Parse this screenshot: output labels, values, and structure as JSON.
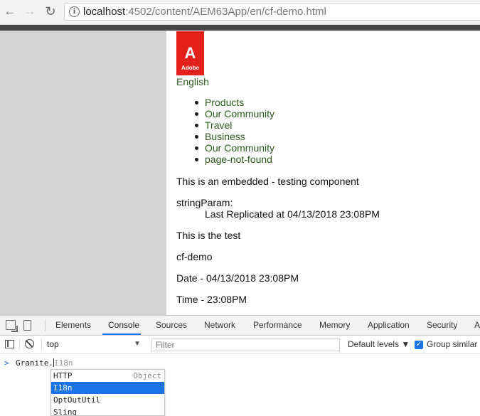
{
  "browser": {
    "url_host": "localhost",
    "url_rest": ":4502/content/AEM63App/en/cf-demo.html"
  },
  "page": {
    "logo_glyph": "A",
    "logo_text": "Adobe",
    "language": "English",
    "nav_items": [
      "Products",
      "Our Community",
      "Travel",
      "Business",
      "Our Community",
      "page-not-found"
    ],
    "embedded_text": "This is an embedded - testing component",
    "string_param_label": "stringParam:",
    "last_replicated": "Last Replicated at 04/13/2018 23:08PM",
    "test_text": "This is the test",
    "page_name": "cf-demo",
    "date_text": "Date - 04/13/2018 23:08PM",
    "time_text": "Time - 23:08PM"
  },
  "devtools": {
    "tabs": [
      "Elements",
      "Console",
      "Sources",
      "Network",
      "Performance",
      "Memory",
      "Application",
      "Security",
      "A"
    ],
    "active_tab": "Console",
    "context": "top",
    "filter_placeholder": "Filter",
    "levels": "Default levels ▼",
    "group_similar": "Group similar",
    "console_input_typed": "Granite.",
    "console_input_ghost": "I18n",
    "autocomplete": [
      {
        "label": "HTTP",
        "type": "Object"
      },
      {
        "label": "I18n",
        "type": ""
      },
      {
        "label": "OptOutUtil",
        "type": ""
      },
      {
        "label": "Sling",
        "type": ""
      }
    ],
    "accent_color": "#1a73e8"
  }
}
